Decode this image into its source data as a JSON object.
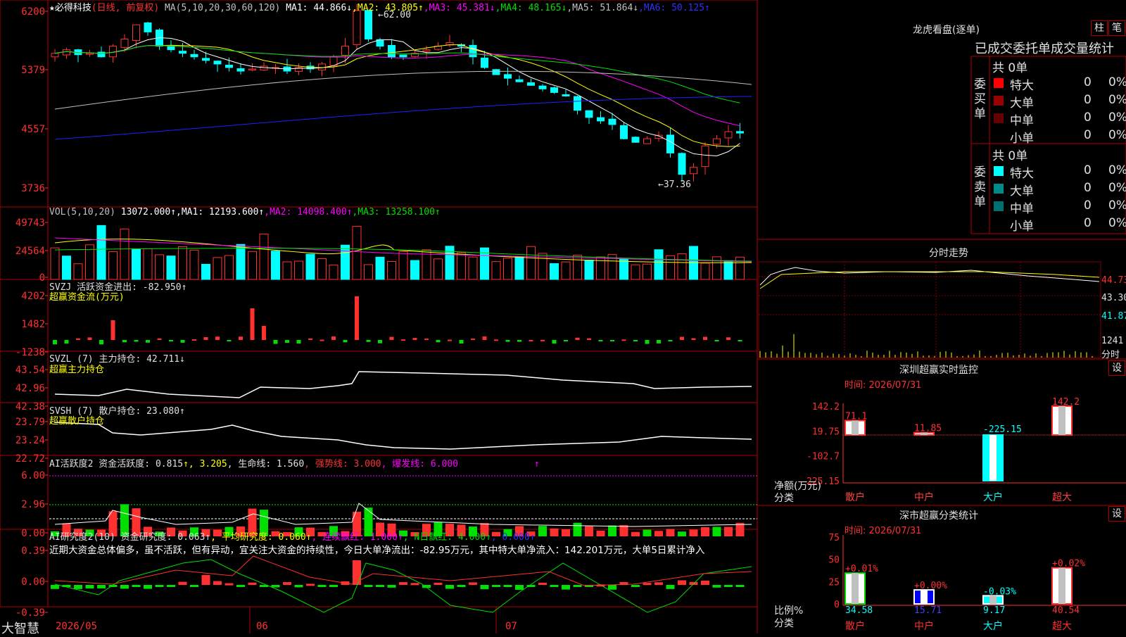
{
  "main": {
    "star": "★",
    "name": "必得科技",
    "period": "(日线, 前复权)",
    "ma_label": "MA(5,10,20,30,60,120)",
    "ma1": "MA1: 44.866↓",
    "ma2": ",MA2: 43.805↑",
    "ma3": ",MA3: 45.381↓",
    "ma4": ",MA4: 48.165↓",
    "ma5": ",MA5: 51.864↓",
    "ma6": ",MA6: 50.125↑",
    "high_label": "←62.00",
    "low_label": "←37.36",
    "y_ticks": [
      "6200",
      "5379",
      "4557",
      "3736"
    ],
    "colors": {
      "ma1": "#ffffff",
      "ma2": "#ffff00",
      "ma3": "#ff00ff",
      "ma4": "#00e000",
      "ma5": "#c0c0c0",
      "ma6": "#2020ff"
    }
  },
  "vol": {
    "label": "VOL(5,10,20)",
    "v": "13072.000↑",
    "ma1": ",MA1: 12193.600↑",
    "ma2": ",MA2: 14098.400↑",
    "ma3": ",MA3: 13258.100↑",
    "y_ticks": [
      "49743",
      "24564",
      "0"
    ]
  },
  "svzj": {
    "label": "SVZJ  活跃资金进出: -82.950↑",
    "sub": "超赢资金流(万元)",
    "y_ticks": [
      "4202",
      "1482",
      "-1238"
    ]
  },
  "svzl": {
    "label": "SVZL (7) 主力持仓: 42.711↓",
    "sub": "超赢主力持仓",
    "y_ticks": [
      "43.54",
      "42.96",
      "42.38"
    ]
  },
  "svsh": {
    "label": "SVSH (7) 散户持仓: 23.080↑",
    "sub": "超赢散户持仓",
    "y_ticks": [
      "23.79",
      "23.24",
      "22.72"
    ]
  },
  "ai1": {
    "label": "AI活跃度2 资金活跃度: 0.815",
    "v2": "↑, 3.205",
    "life": ", 生命线: 1.560",
    "strong": ", 强势线: 3.000",
    "burst": ", 爆发线: 6.000",
    "arrow": "↑",
    "y_ticks": [
      "6.00",
      "2.96",
      "0.00"
    ]
  },
  "ai2": {
    "label": "AI研究度2(10) 资金研究度: 0.063↑",
    "avg": ", 平均研究度: 0.060↑",
    "lian": ", 连续飘红: 1.000↑",
    "nri": ", N日飘红: 4.000↑",
    "last": ", 0.000↑",
    "comment": "近期大资金总体偏多，虽不活跃，但有异动，宜关注大资金的持续性，今日大单净流出：-82.95万元，其中特大单净流入：142.201万元，大单5日累计净入",
    "y_ticks": [
      "0.39",
      "0.00",
      "-0.39"
    ]
  },
  "xaxis": {
    "logo": "大智慧",
    "m1": "2026/05",
    "m2": "06",
    "m3": "07"
  },
  "lhb": {
    "title": "龙虎看盘(逐单)",
    "btn1": "柱",
    "btn2": "笔",
    "sub": "已成交委托单成交量统计",
    "buy_side": "委买单",
    "sell_side": "委卖单",
    "buy_total": "共 0单",
    "sell_total": "共 0单",
    "buy_rows": [
      {
        "name": "特大",
        "n": "0",
        "p": "0%",
        "color": "#ff0000"
      },
      {
        "name": "大单",
        "n": "0",
        "p": "0%",
        "color": "#990000"
      },
      {
        "name": "中单",
        "n": "0",
        "p": "0%",
        "color": "#660000"
      },
      {
        "name": "小单",
        "n": "0",
        "p": "0%",
        "color": "#000000"
      }
    ],
    "sell_rows": [
      {
        "name": "特大",
        "n": "0",
        "p": "0%",
        "color": "#00ffff"
      },
      {
        "name": "大单",
        "n": "0",
        "p": "0%",
        "color": "#008b8b"
      },
      {
        "name": "中单",
        "n": "0",
        "p": "0%",
        "color": "#007070"
      },
      {
        "name": "小单",
        "n": "0",
        "p": "0%",
        "color": "#000000"
      }
    ]
  },
  "fs": {
    "title": "分时走势",
    "p1": "44.73",
    "p2": "43.30",
    "p3": "41.87",
    "v1": "1241",
    "v2": "分时"
  },
  "sz": {
    "title": "深圳超赢实时监控",
    "btn": "设",
    "time": "时间: 2026/07/31",
    "y_ticks": [
      "142.2",
      "19.75",
      "-102.7",
      "-225.15"
    ],
    "ylabel1": "净额(万元)",
    "ylabel2": "分类",
    "bars": [
      {
        "cat": "散户",
        "value": 71.1,
        "label": "71.1",
        "catcolor": "#ff4040"
      },
      {
        "cat": "中户",
        "value": 11.85,
        "label": "11.85",
        "catcolor": "#ff4040"
      },
      {
        "cat": "大户",
        "value": -225.15,
        "label": "-225.15",
        "catcolor": "#00ffff"
      },
      {
        "cat": "超大",
        "value": 142.2,
        "label": "142.2",
        "catcolor": "#ff4040"
      }
    ]
  },
  "fl": {
    "title": "深市超赢分类统计",
    "btn": "设",
    "time": "时间: 2026/07/31",
    "y_ticks": [
      "75",
      "50",
      "25",
      "0"
    ],
    "ylabel1": "比例%",
    "ylabel2": "分类",
    "bars": [
      {
        "cat": "散户",
        "value": 34.58,
        "label": "34.58",
        "change": "+0.01%"
      },
      {
        "cat": "中户",
        "value": 15.71,
        "label": "15.71",
        "change": "+0.00%"
      },
      {
        "cat": "大户",
        "value": 9.17,
        "label": "9.17",
        "change": "-0.03%"
      },
      {
        "cat": "超大",
        "value": 40.54,
        "label": "40.54",
        "change": "+0.02%"
      }
    ]
  }
}
